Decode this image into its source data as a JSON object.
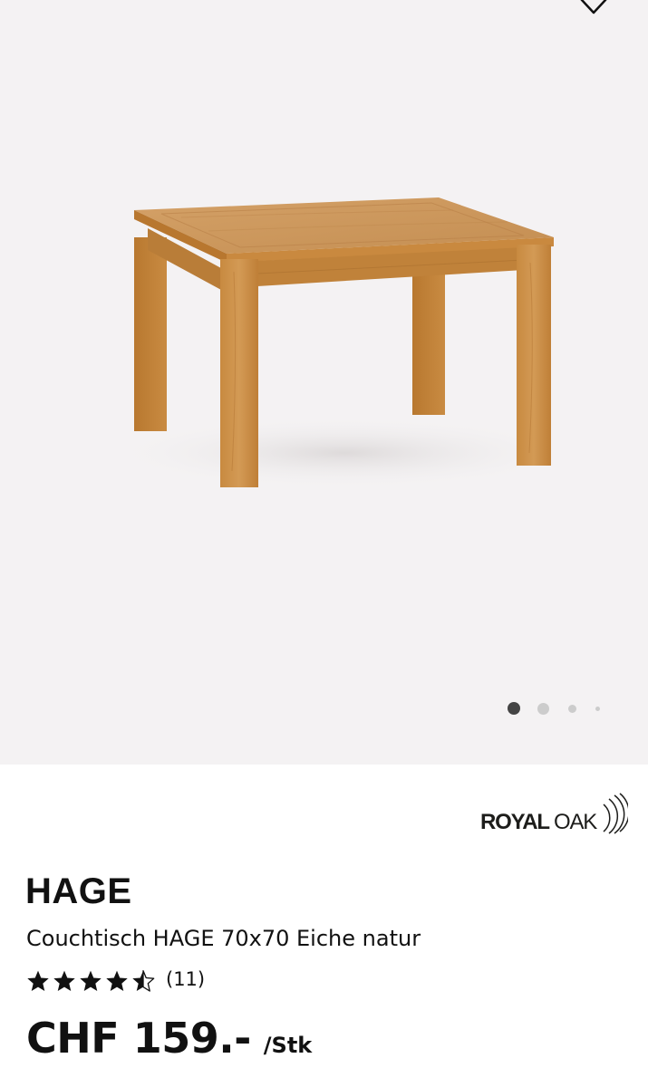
{
  "product": {
    "name": "HAGE",
    "description": "Couchtisch HAGE 70x70 Eiche natur",
    "rating": 4.5,
    "rating_max": 5,
    "review_count": "(11)",
    "price": "CHF 159.-",
    "price_unit": "/Stk",
    "brand_royal": "ROYAL",
    "brand_oak": "OAK",
    "image_label": "wooden-coffee-table"
  },
  "gallery": {
    "image_count": 4,
    "active_index": 0
  },
  "icons": {
    "wishlist": "heart-icon",
    "star": "star-icon"
  },
  "colors": {
    "gallery_bg": "#f4f2f3",
    "wood": "#c48a45",
    "active_dot": "#444444",
    "inactive_dot": "#cccccc"
  }
}
